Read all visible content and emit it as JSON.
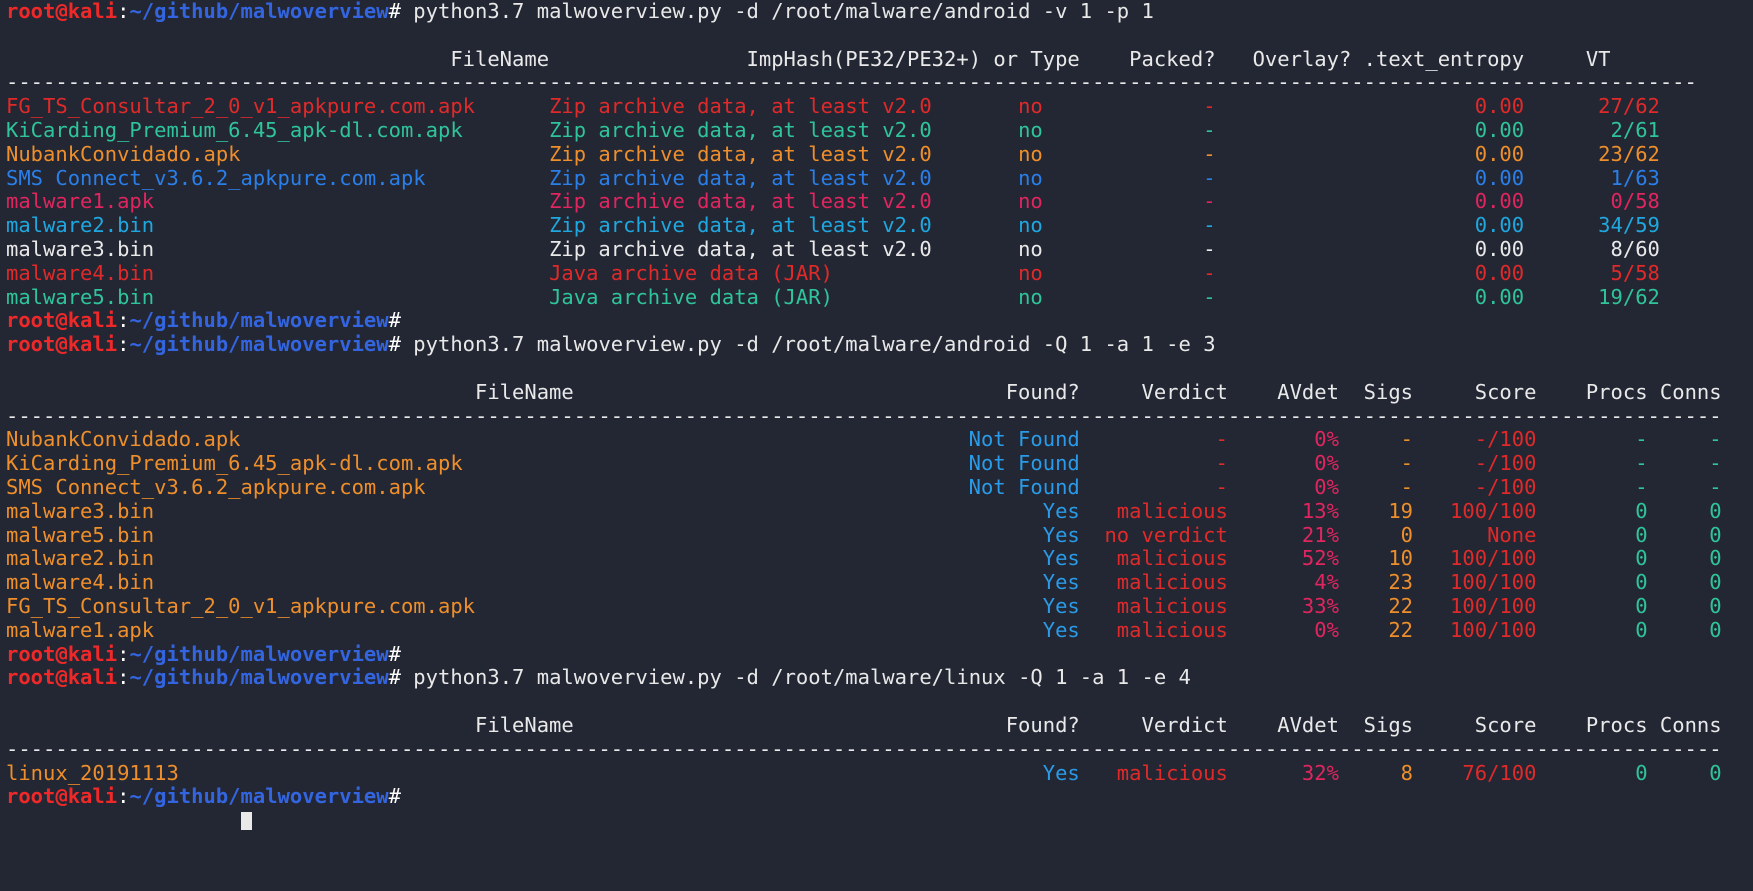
{
  "terminal": {
    "background": "#232733",
    "prompt": {
      "user": "root",
      "at": "@",
      "host": "kali",
      "colon": ":",
      "path": "~/github/malwoverview",
      "hash": "#"
    },
    "cursor_visible": true
  },
  "commands": {
    "cmd1": " python3.7 malwoverview.py -d /root/malware/android -v 1 -p 1",
    "cmd2": " python3.7 malwoverview.py -d /root/malware/android -Q 1 -a 1 -e 3",
    "cmd3": " python3.7 malwoverview.py -d /root/malware/linux -Q 1 -a 1 -e 4",
    "empty": ""
  },
  "separator": "-------------------------------------------------------------------------------------------------------------------------------------------------",
  "table1": {
    "header": {
      "filename": "FileName",
      "imphash": "ImpHash(PE32/PE32+) or Type",
      "packed": "Packed?",
      "overlay": "Overlay?",
      "entropy": ".text_entropy",
      "vt": "VT"
    },
    "rows": [
      {
        "filename": "FG_TS_Consultar_2_0_v1_apkpure.com.apk",
        "type": "Zip archive data, at least v2.0",
        "packed": "no",
        "overlay": "-",
        "entropy": "0.00",
        "vt": "27/62",
        "color": "c-red"
      },
      {
        "filename": "KiCarding_Premium_6.45_apk-dl.com.apk",
        "type": "Zip archive data, at least v2.0",
        "packed": "no",
        "overlay": "-",
        "entropy": "0.00",
        "vt": "2/61",
        "color": "c-green"
      },
      {
        "filename": "NubankConvidado.apk",
        "type": "Zip archive data, at least v2.0",
        "packed": "no",
        "overlay": "-",
        "entropy": "0.00",
        "vt": "23/62",
        "color": "c-orange"
      },
      {
        "filename": "SMS Connect_v3.6.2_apkpure.com.apk",
        "type": "Zip archive data, at least v2.0",
        "packed": "no",
        "overlay": "-",
        "entropy": "0.00",
        "vt": "1/63",
        "color": "c-blue"
      },
      {
        "filename": "malware1.apk",
        "type": "Zip archive data, at least v2.0",
        "packed": "no",
        "overlay": "-",
        "entropy": "0.00",
        "vt": "0/58",
        "color": "c-pink"
      },
      {
        "filename": "malware2.bin",
        "type": "Zip archive data, at least v2.0",
        "packed": "no",
        "overlay": "-",
        "entropy": "0.00",
        "vt": "34/59",
        "color": "c-cyan"
      },
      {
        "filename": "malware3.bin",
        "type": "Zip archive data, at least v2.0",
        "packed": "no",
        "overlay": "-",
        "entropy": "0.00",
        "vt": "8/60",
        "color": "c-white"
      },
      {
        "filename": "malware4.bin",
        "type": "Java archive data (JAR)",
        "packed": "no",
        "overlay": "-",
        "entropy": "0.00",
        "vt": "5/58",
        "color": "c-red"
      },
      {
        "filename": "malware5.bin",
        "type": "Java archive data (JAR)",
        "packed": "no",
        "overlay": "-",
        "entropy": "0.00",
        "vt": "19/62",
        "color": "c-green"
      }
    ]
  },
  "table2": {
    "header": {
      "filename": "FileName",
      "found": "Found?",
      "verdict": "Verdict",
      "avdet": "AVdet",
      "sigs": "Sigs",
      "score": "Score",
      "procs": "Procs",
      "conns": "Conns"
    },
    "rows": [
      {
        "filename": "NubankConvidado.apk",
        "found": "Not Found",
        "verdict": "-",
        "avdet": "0%",
        "sigs": "-",
        "score": "-/100",
        "procs": "-",
        "conns": "-"
      },
      {
        "filename": "KiCarding_Premium_6.45_apk-dl.com.apk",
        "found": "Not Found",
        "verdict": "-",
        "avdet": "0%",
        "sigs": "-",
        "score": "-/100",
        "procs": "-",
        "conns": "-"
      },
      {
        "filename": "SMS Connect_v3.6.2_apkpure.com.apk",
        "found": "Not Found",
        "verdict": "-",
        "avdet": "0%",
        "sigs": "-",
        "score": "-/100",
        "procs": "-",
        "conns": "-"
      },
      {
        "filename": "malware3.bin",
        "found": "Yes",
        "verdict": "malicious",
        "avdet": "13%",
        "sigs": "19",
        "score": "100/100",
        "procs": "0",
        "conns": "0"
      },
      {
        "filename": "malware5.bin",
        "found": "Yes",
        "verdict": "no verdict",
        "avdet": "21%",
        "sigs": "0",
        "score": "None",
        "procs": "0",
        "conns": "0"
      },
      {
        "filename": "malware2.bin",
        "found": "Yes",
        "verdict": "malicious",
        "avdet": "52%",
        "sigs": "10",
        "score": "100/100",
        "procs": "0",
        "conns": "0"
      },
      {
        "filename": "malware4.bin",
        "found": "Yes",
        "verdict": "malicious",
        "avdet": "4%",
        "sigs": "23",
        "score": "100/100",
        "procs": "0",
        "conns": "0"
      },
      {
        "filename": "FG_TS_Consultar_2_0_v1_apkpure.com.apk",
        "found": "Yes",
        "verdict": "malicious",
        "avdet": "33%",
        "sigs": "22",
        "score": "100/100",
        "procs": "0",
        "conns": "0"
      },
      {
        "filename": "malware1.apk",
        "found": "Yes",
        "verdict": "malicious",
        "avdet": "0%",
        "sigs": "22",
        "score": "100/100",
        "procs": "0",
        "conns": "0"
      }
    ]
  },
  "table3": {
    "header": {
      "filename": "FileName",
      "found": "Found?",
      "verdict": "Verdict",
      "avdet": "AVdet",
      "sigs": "Sigs",
      "score": "Score",
      "procs": "Procs",
      "conns": "Conns"
    },
    "rows": [
      {
        "filename": "linux_20191113",
        "found": "Yes",
        "verdict": "malicious",
        "avdet": "32%",
        "sigs": "8",
        "score": "76/100",
        "procs": "0",
        "conns": "0"
      }
    ]
  },
  "colors": {
    "red": "#e02a2a",
    "green": "#2fc49a",
    "orange": "#ef8f2b",
    "blue": "#2a7fe8",
    "pink": "#e0255f",
    "cyan": "#1fa8e0",
    "white": "#e9e9ea",
    "prompt_user": "#ef2929",
    "prompt_path": "#3465e0",
    "background": "#232733"
  }
}
